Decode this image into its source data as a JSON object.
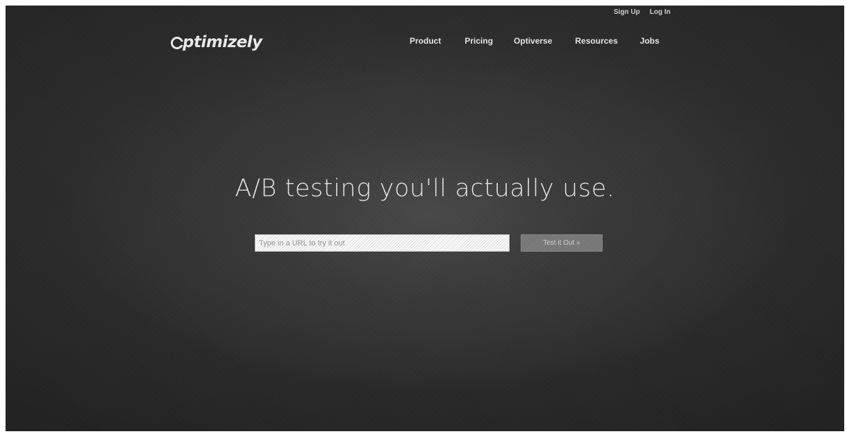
{
  "topbar": {
    "sign_up": "Sign Up",
    "log_in": "Log In"
  },
  "logo": {
    "text": "ptimizely"
  },
  "nav": {
    "items": [
      {
        "label": "Product"
      },
      {
        "label": "Pricing"
      },
      {
        "label": "Optiverse"
      },
      {
        "label": "Resources"
      },
      {
        "label": "Jobs"
      }
    ]
  },
  "hero": {
    "headline": "A/B testing you'll actually use.",
    "url_input_placeholder": "Type in a URL to try it out",
    "url_input_value": "",
    "button_label": "Test it Out »"
  },
  "colors": {
    "background": "#2b2b2b",
    "text": "#eeeeee",
    "input_background": "#fbfbfb",
    "button_background": "#7c7c7c"
  },
  "icons": {
    "logo_mark": "optimizely-logo-icon"
  }
}
